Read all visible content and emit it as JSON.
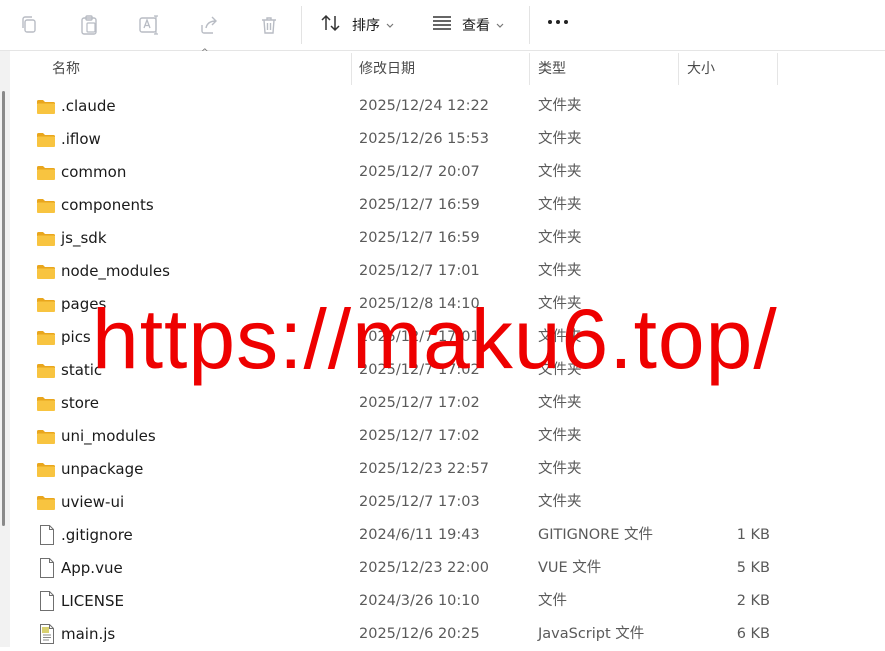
{
  "toolbar": {
    "sort_label": "排序",
    "view_label": "查看",
    "icons": [
      "copy-icon",
      "paste-icon",
      "rename-icon",
      "share-icon",
      "delete-icon",
      "sort-icon",
      "view-icon",
      "more-icon"
    ]
  },
  "columns": {
    "name": "名称",
    "date": "修改日期",
    "type": "类型",
    "size": "大小",
    "sorted_by": "名称"
  },
  "files": [
    {
      "name": ".claude",
      "date": "2025/12/24 12:22",
      "type": "文件夹",
      "size": "",
      "icon": "folder"
    },
    {
      "name": ".iflow",
      "date": "2025/12/26 15:53",
      "type": "文件夹",
      "size": "",
      "icon": "folder"
    },
    {
      "name": "common",
      "date": "2025/12/7 20:07",
      "type": "文件夹",
      "size": "",
      "icon": "folder"
    },
    {
      "name": "components",
      "date": "2025/12/7 16:59",
      "type": "文件夹",
      "size": "",
      "icon": "folder"
    },
    {
      "name": "js_sdk",
      "date": "2025/12/7 16:59",
      "type": "文件夹",
      "size": "",
      "icon": "folder"
    },
    {
      "name": "node_modules",
      "date": "2025/12/7 17:01",
      "type": "文件夹",
      "size": "",
      "icon": "folder"
    },
    {
      "name": "pages",
      "date": "2025/12/8 14:10",
      "type": "文件夹",
      "size": "",
      "icon": "folder"
    },
    {
      "name": "pics",
      "date": "2025/12/7 17:01",
      "type": "文件夹",
      "size": "",
      "icon": "folder"
    },
    {
      "name": "static",
      "date": "2025/12/7 17:02",
      "type": "文件夹",
      "size": "",
      "icon": "folder"
    },
    {
      "name": "store",
      "date": "2025/12/7 17:02",
      "type": "文件夹",
      "size": "",
      "icon": "folder"
    },
    {
      "name": "uni_modules",
      "date": "2025/12/7 17:02",
      "type": "文件夹",
      "size": "",
      "icon": "folder"
    },
    {
      "name": "unpackage",
      "date": "2025/12/23 22:57",
      "type": "文件夹",
      "size": "",
      "icon": "folder"
    },
    {
      "name": "uview-ui",
      "date": "2025/12/7 17:03",
      "type": "文件夹",
      "size": "",
      "icon": "folder"
    },
    {
      "name": ".gitignore",
      "date": "2024/6/11 19:43",
      "type": "GITIGNORE 文件",
      "size": "1 KB",
      "icon": "file"
    },
    {
      "name": "App.vue",
      "date": "2025/12/23 22:00",
      "type": "VUE 文件",
      "size": "5 KB",
      "icon": "file"
    },
    {
      "name": "LICENSE",
      "date": "2024/3/26 10:10",
      "type": "文件",
      "size": "2 KB",
      "icon": "file"
    },
    {
      "name": "main.js",
      "date": "2025/12/6 20:25",
      "type": "JavaScript 文件",
      "size": "6 KB",
      "icon": "js"
    }
  ],
  "watermark": "https://maku6.top/",
  "colors": {
    "folder": "#f8c440",
    "folder_dark": "#e9a61d",
    "watermark": "#ee0000"
  }
}
